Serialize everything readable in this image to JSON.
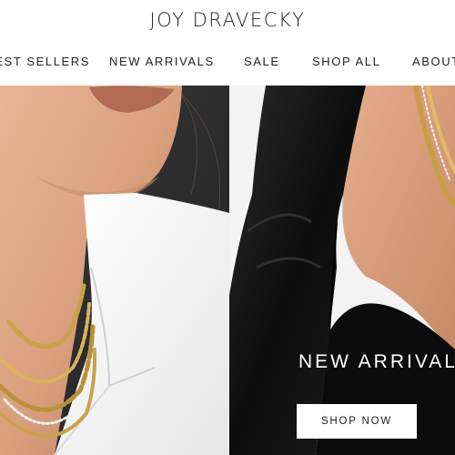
{
  "header": {
    "logo": "JOY DRAVECKY",
    "nav": {
      "best_sellers": "BEST SELLERS",
      "new_arrivals": "NEW ARRIVALS",
      "sale": "SALE",
      "shop_all": "SHOP ALL",
      "about": "ABOUT"
    }
  },
  "hero": {
    "title": "NEW ARRIVALS",
    "cta_label": "SHOP NOW"
  }
}
